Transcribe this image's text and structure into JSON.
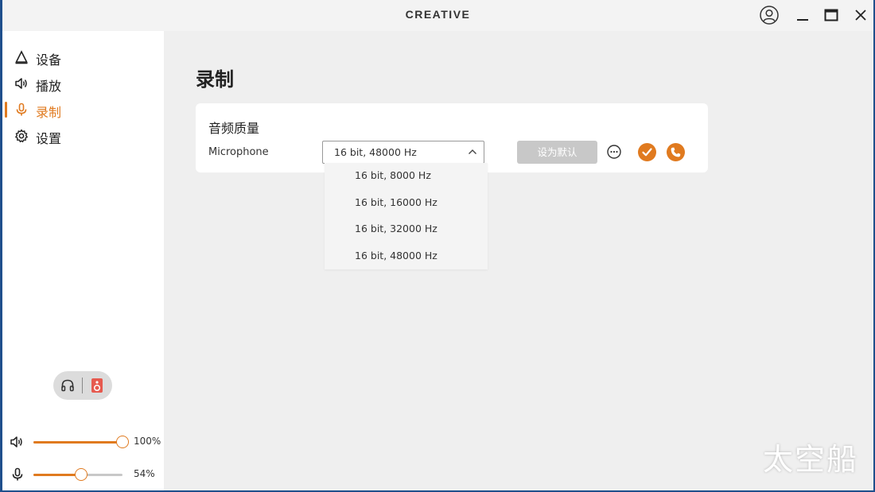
{
  "app": {
    "brand": "CREATIVE"
  },
  "sidebar": {
    "items": [
      {
        "label": "设备",
        "icon": "device-triangle-icon",
        "active": false
      },
      {
        "label": "播放",
        "icon": "speaker-icon",
        "active": false
      },
      {
        "label": "录制",
        "icon": "microphone-icon",
        "active": true
      },
      {
        "label": "设置",
        "icon": "gear-icon",
        "active": false
      }
    ],
    "output_toggle": {
      "left_icon": "headphones-icon",
      "right_icon": "speaker-box-icon"
    },
    "volume": {
      "icon": "speaker-icon",
      "level": 100,
      "label": "100%"
    },
    "mic": {
      "icon": "microphone-icon",
      "level": 54,
      "label": "54%"
    }
  },
  "main": {
    "title": "录制",
    "card": {
      "heading": "音频质量",
      "device_label": "Microphone",
      "selected": "16 bit, 48000 Hz",
      "default_button": "设为默认",
      "options": [
        "16 bit, 8000 Hz",
        "16 bit, 16000 Hz",
        "16 bit, 32000 Hz",
        "16 bit, 48000 Hz"
      ]
    }
  },
  "watermark": "太空船",
  "colors": {
    "accent": "#e07a1f",
    "sidebar_bg": "#ffffff",
    "content_bg": "#efefef",
    "disabled_button": "#c8c8c8"
  }
}
